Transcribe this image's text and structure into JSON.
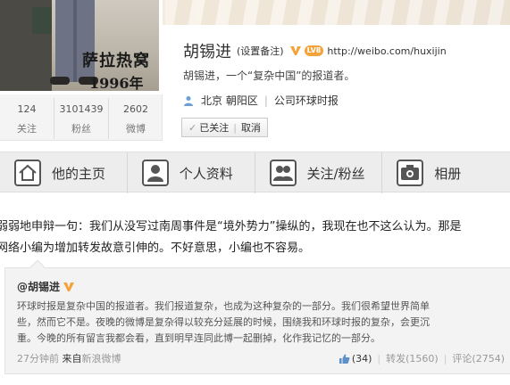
{
  "avatar": {
    "title": "萨拉热窝",
    "year": "1996年"
  },
  "stats": [
    {
      "num": "124",
      "label": "关注"
    },
    {
      "num": "3101439",
      "label": "粉丝"
    },
    {
      "num": "2602",
      "label": "微博"
    }
  ],
  "profile": {
    "name": "胡锡进",
    "remark": "(设置备注)",
    "level": "LV8",
    "url": "http://weibo.com/huxijin",
    "bio": "胡锡进，一个“复杂中国”的报道者。",
    "location": "北京 朝阳区",
    "company": "公司环球时报",
    "follow_status": "已关注",
    "cancel_label": "取消"
  },
  "tabs": [
    {
      "label": "他的主页",
      "icon": "home-icon"
    },
    {
      "label": "个人资料",
      "icon": "profile-icon"
    },
    {
      "label": "关注/粉丝",
      "icon": "users-icon"
    },
    {
      "label": "相册",
      "icon": "camera-icon"
    }
  ],
  "post": {
    "lines": [
      "弱弱地申辩一句：我们从没写过南周事件是“境外势力”操纵的，我现在也不这么认为。那是",
      "网络小编为增加转发故意引伸的。不好意思，小编也不容易。"
    ]
  },
  "repost": {
    "author": "@胡锡进",
    "lines": [
      "环球时报是复杂中国的报道者。我们报道复杂，也成为这种复杂的一部分。我们很希望世界简单",
      "些，然而它不是。夜晚的微博是复杂得以较充分延展的时候，围绕我和环球时报的复杂，会更沉",
      "重。今晚的所有留言我都会看，直到明早连同此博一起删掉，化作我记忆的一部分。"
    ],
    "time": "27分钟前",
    "from_label": "来自",
    "source": "新浪微博",
    "likes": "(34)",
    "reposts": "转发(1560)",
    "comments": "评论(2754)"
  },
  "colors": {
    "v_badge": "#f3a33a",
    "level_badge": "#f3a33a",
    "tab_bg": "#ededed",
    "repost_bg": "#f3f3f3"
  }
}
